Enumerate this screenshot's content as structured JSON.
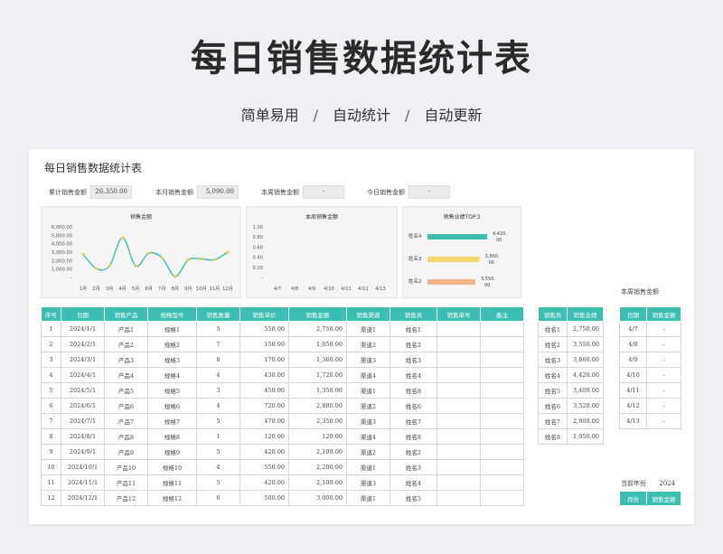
{
  "hero": {
    "title": "每日销售数据统计表",
    "sub1": "简单易用",
    "sub2": "自动统计",
    "sub3": "自动更新",
    "separator": "/"
  },
  "sheet": {
    "title": "每日销售数据统计表",
    "kpis": [
      {
        "label": "累计销售金额",
        "value": "26,350.00"
      },
      {
        "label": "本月销售金额",
        "value": "5,090.00"
      },
      {
        "label": "本周销售金额",
        "value": "-"
      },
      {
        "label": "今日销售金额",
        "value": "-"
      }
    ],
    "week_sales_label": "本周销售金额",
    "current_year_label": "当前年份",
    "current_year_value": "2024"
  },
  "chart_data": [
    {
      "type": "line",
      "title": "销售金额",
      "categories": [
        "1月",
        "2月",
        "3月",
        "4月",
        "5月",
        "6月",
        "7月",
        "8月",
        "9月",
        "10月",
        "11月",
        "12月"
      ],
      "values": [
        2750,
        1050,
        1360,
        4720,
        1350,
        2880,
        2350,
        120,
        2100,
        2200,
        2100,
        3000
      ],
      "ylim": [
        0,
        6000
      ],
      "yticks": [
        "6,000.00",
        "5,000.00",
        "4,000.00",
        "3,000.00",
        "2,000.00",
        "1,000.00",
        "-"
      ],
      "color": "#3cbeb2",
      "point_color": "#f3c844"
    },
    {
      "type": "line",
      "title": "本周销售金额",
      "categories": [
        "4/7",
        "4/8",
        "4/9",
        "4/10",
        "4/11",
        "4/12",
        "4/13"
      ],
      "values": [
        0,
        0,
        0,
        0,
        0,
        0,
        0
      ],
      "ylim": [
        0,
        1
      ],
      "yticks": [
        "1.00",
        "0.80",
        "0.60",
        "0.40",
        "0.20",
        "-"
      ]
    },
    {
      "type": "bar",
      "orientation": "horizontal",
      "title": "销售业绩TOP.3",
      "categories": [
        "姓名4",
        "姓名3",
        "姓名2"
      ],
      "values": [
        4420,
        3860,
        3550
      ],
      "value_labels": [
        "4,420.00",
        "3,860.00",
        "3,550.00"
      ],
      "colors": [
        "#3cbeb2",
        "#f5d76e",
        "#f2b48a"
      ]
    }
  ],
  "main_table": {
    "headers": [
      "序号",
      "日期",
      "销售产品",
      "规格型号",
      "销售数量",
      "销售单价",
      "销售金额",
      "销售渠道",
      "销售员",
      "销售单号",
      "备注"
    ],
    "rows": [
      [
        "1",
        "2024/1/1",
        "产品1",
        "规格1",
        "5",
        "550.00",
        "2,750.00",
        "渠道1",
        "姓名1",
        "",
        ""
      ],
      [
        "2",
        "2024/2/1",
        "产品2",
        "规格2",
        "7",
        "150.00",
        "1,050.00",
        "渠道2",
        "姓名2",
        "",
        ""
      ],
      [
        "3",
        "2024/3/1",
        "产品3",
        "规格3",
        "8",
        "170.00",
        "1,360.00",
        "渠道3",
        "姓名3",
        "",
        ""
      ],
      [
        "4",
        "2024/4/1",
        "产品4",
        "规格4",
        "4",
        "430.00",
        "1,720.00",
        "渠道4",
        "姓名4",
        "",
        ""
      ],
      [
        "5",
        "2024/5/1",
        "产品5",
        "规格5",
        "3",
        "450.00",
        "1,350.00",
        "渠道1",
        "姓名8",
        "",
        ""
      ],
      [
        "6",
        "2024/6/1",
        "产品6",
        "规格6",
        "4",
        "720.00",
        "2,880.00",
        "渠道2",
        "姓名6",
        "",
        ""
      ],
      [
        "7",
        "2024/7/1",
        "产品7",
        "规格7",
        "5",
        "470.00",
        "2,350.00",
        "渠道3",
        "姓名7",
        "",
        ""
      ],
      [
        "8",
        "2024/8/1",
        "产品8",
        "规格8",
        "1",
        "120.00",
        "120.00",
        "渠道4",
        "姓名8",
        "",
        ""
      ],
      [
        "9",
        "2024/9/1",
        "产品9",
        "规格9",
        "5",
        "420.00",
        "2,100.00",
        "渠道2",
        "姓名2",
        "",
        ""
      ],
      [
        "10",
        "2024/10/1",
        "产品10",
        "规格10",
        "4",
        "550.00",
        "2,200.00",
        "渠道1",
        "姓名3",
        "",
        ""
      ],
      [
        "11",
        "2024/11/1",
        "产品11",
        "规格11",
        "5",
        "420.00",
        "2,100.00",
        "渠道3",
        "姓名4",
        "",
        ""
      ],
      [
        "12",
        "2024/12/1",
        "产品12",
        "规格12",
        "6",
        "500.00",
        "3,000.00",
        "渠道1",
        "姓名5",
        "",
        ""
      ]
    ]
  },
  "staff_table": {
    "headers": [
      "销售员",
      "销售业绩"
    ],
    "rows": [
      [
        "姓名1",
        "2,750.00"
      ],
      [
        "姓名2",
        "3,550.00"
      ],
      [
        "姓名3",
        "3,860.00"
      ],
      [
        "姓名4",
        "4,420.00"
      ],
      [
        "姓名5",
        "3,400.00"
      ],
      [
        "姓名6",
        "3,520.00"
      ],
      [
        "姓名7",
        "2,900.00"
      ],
      [
        "姓名8",
        "1,950.00"
      ]
    ]
  },
  "week_table": {
    "headers": [
      "日期",
      "销售金额"
    ],
    "rows": [
      [
        "4/7",
        "-"
      ],
      [
        "4/8",
        "-"
      ],
      [
        "4/9",
        "-"
      ],
      [
        "4/10",
        "-"
      ],
      [
        "4/11",
        "-"
      ],
      [
        "4/12",
        "-"
      ],
      [
        "4/13",
        "-"
      ]
    ]
  },
  "month_table": {
    "headers": [
      "月份",
      "销售金额"
    ]
  }
}
